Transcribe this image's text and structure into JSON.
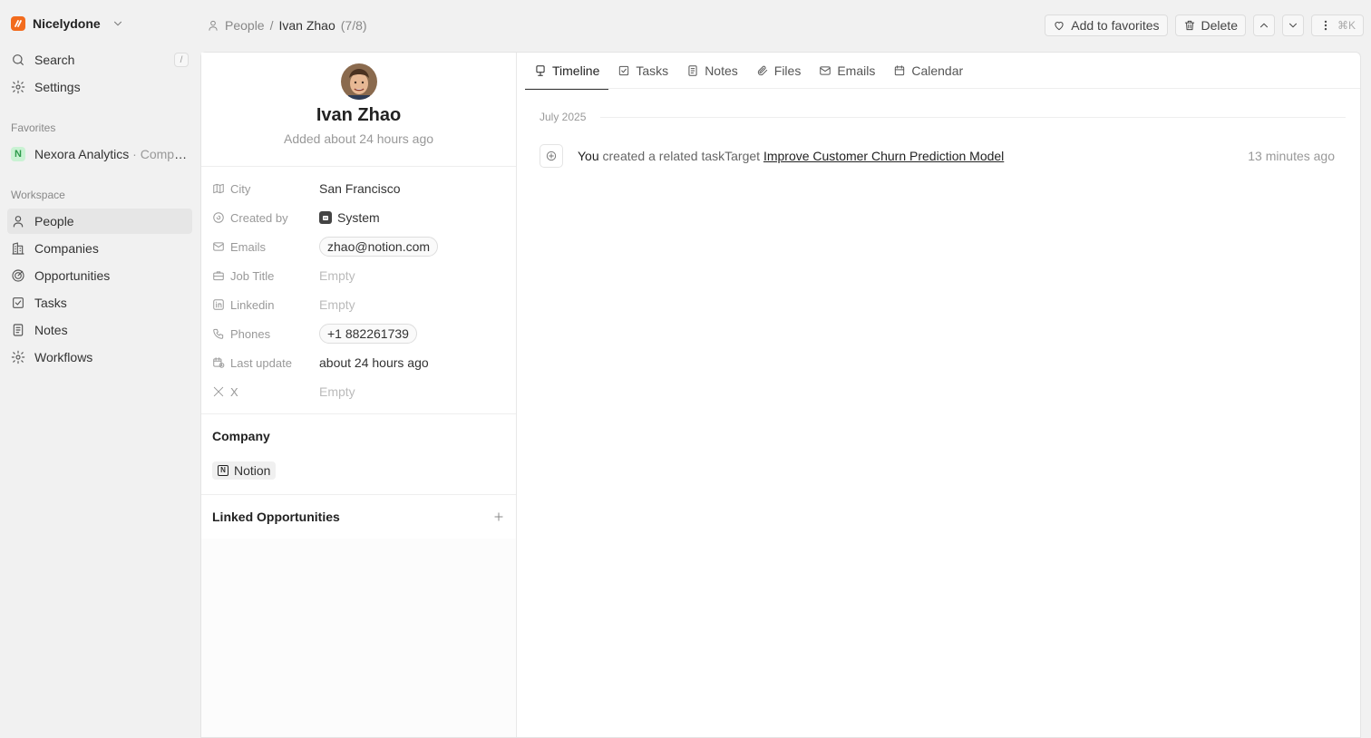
{
  "workspace": {
    "name": "Nicelydone"
  },
  "sidebar": {
    "search_label": "Search",
    "search_shortcut": "/",
    "settings_label": "Settings",
    "favorites_title": "Favorites",
    "favorites": [
      {
        "badge": "N",
        "name": "Nexora Analytics",
        "type": "· Compa..."
      }
    ],
    "workspace_title": "Workspace",
    "items": [
      {
        "label": "People",
        "icon": "person-icon"
      },
      {
        "label": "Companies",
        "icon": "building-icon"
      },
      {
        "label": "Opportunities",
        "icon": "target-icon"
      },
      {
        "label": "Tasks",
        "icon": "checkbox-icon"
      },
      {
        "label": "Notes",
        "icon": "note-icon"
      },
      {
        "label": "Workflows",
        "icon": "gear-icon"
      }
    ]
  },
  "breadcrumb": {
    "parent": "People",
    "separator": "/",
    "current": "Ivan Zhao",
    "count": "(7/8)"
  },
  "toolbar": {
    "favorite_label": "Add to favorites",
    "delete_label": "Delete",
    "more_shortcut": "⌘K"
  },
  "profile": {
    "name": "Ivan Zhao",
    "added": "Added about 24 hours ago"
  },
  "fields": [
    {
      "key": "City",
      "value": "San Francisco",
      "kind": "text",
      "icon": "map-icon"
    },
    {
      "key": "Created by",
      "value": "System",
      "kind": "system",
      "icon": "created-icon"
    },
    {
      "key": "Emails",
      "value": "zhao@notion.com",
      "kind": "chip",
      "icon": "mail-icon"
    },
    {
      "key": "Job Title",
      "value": "Empty",
      "kind": "empty",
      "icon": "briefcase-icon"
    },
    {
      "key": "Linkedin",
      "value": "Empty",
      "kind": "empty",
      "icon": "linkedin-icon"
    },
    {
      "key": "Phones",
      "value": "+1 882261739",
      "kind": "chip",
      "icon": "phone-icon"
    },
    {
      "key": "Last update",
      "value": "about 24 hours ago",
      "kind": "text",
      "icon": "calendar-clock-icon"
    },
    {
      "key": "X",
      "value": "Empty",
      "kind": "empty",
      "icon": "x-icon"
    }
  ],
  "company": {
    "title": "Company",
    "name": "Notion"
  },
  "linked": {
    "title": "Linked Opportunities"
  },
  "tabs": [
    {
      "label": "Timeline",
      "active": true
    },
    {
      "label": "Tasks",
      "active": false
    },
    {
      "label": "Notes",
      "active": false
    },
    {
      "label": "Files",
      "active": false
    },
    {
      "label": "Emails",
      "active": false
    },
    {
      "label": "Calendar",
      "active": false
    }
  ],
  "timeline": {
    "month": "July 2025",
    "events": [
      {
        "actor": "You",
        "action": "created a related taskTarget",
        "link": "Improve Customer Churn Prediction Model",
        "time": "13 minutes ago"
      }
    ]
  }
}
